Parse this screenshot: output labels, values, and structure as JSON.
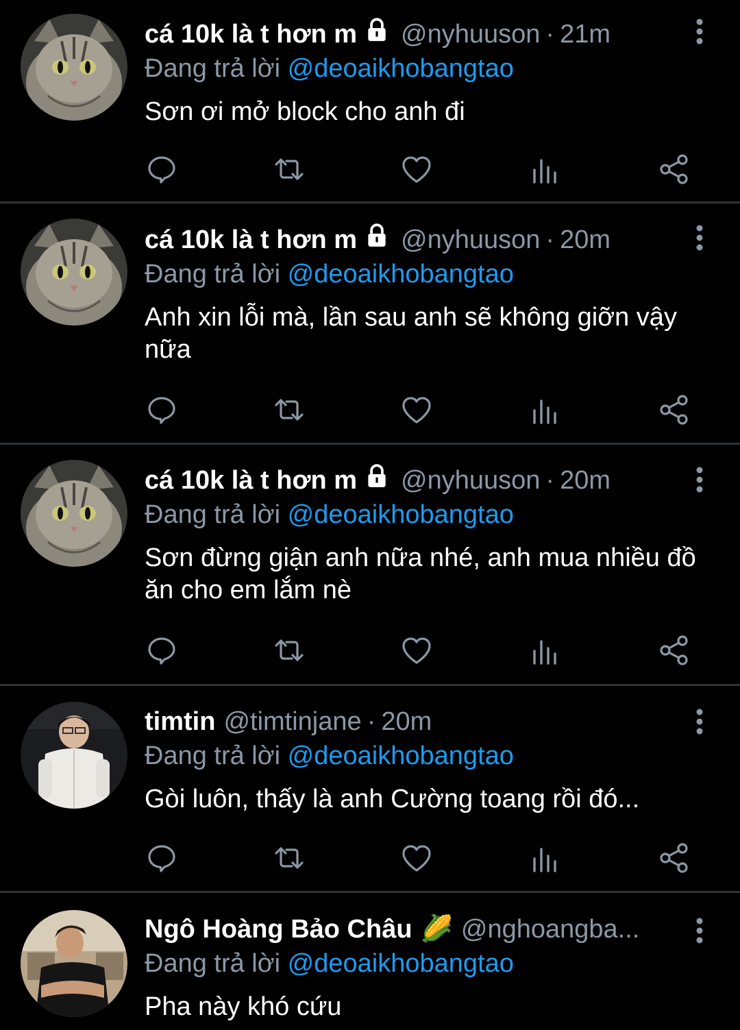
{
  "theme": {
    "background": "#000000",
    "text": "#ffffff",
    "muted": "#8b98a5",
    "mention": "#1d9bf0",
    "divider": "#2f3336"
  },
  "tweets": [
    {
      "name": "cá 10k là t hơn m",
      "protected": true,
      "handle": "@nyhuuson",
      "sep": "·",
      "time": "21m",
      "reply_prefix": "Đang trả lời",
      "reply_to": "@deoaikhobangtao",
      "text": "Sơn ơi mở block cho anh đi",
      "avatar": "cat-avatar"
    },
    {
      "name": "cá 10k là t hơn m",
      "protected": true,
      "handle": "@nyhuuson",
      "sep": "·",
      "time": "20m",
      "reply_prefix": "Đang trả lời",
      "reply_to": "@deoaikhobangtao",
      "text": "Anh xin lỗi mà, lần sau anh sẽ không giỡn vậy nữa",
      "avatar": "cat-avatar"
    },
    {
      "name": "cá 10k là t hơn m",
      "protected": true,
      "handle": "@nyhuuson",
      "sep": "·",
      "time": "20m",
      "reply_prefix": "Đang trả lời",
      "reply_to": "@deoaikhobangtao",
      "text": "Sơn đừng giận anh nữa nhé, anh mua nhiều đồ ăn cho em lắm nè",
      "avatar": "cat-avatar"
    },
    {
      "name": "timtin",
      "protected": false,
      "handle": "@timtinjane",
      "sep": "·",
      "time": "20m",
      "reply_prefix": "Đang trả lời",
      "reply_to": "@deoaikhobangtao",
      "text": "Gòi luôn, thấy là anh Cường toang rồi đó...",
      "avatar": "person-white-shirt-avatar"
    },
    {
      "name": "Ngô Hoàng Bảo Châu",
      "emoji": "🌽",
      "protected": false,
      "handle": "@nghoangba...",
      "reply_prefix": "Đang trả lời",
      "reply_to": "@deoaikhobangtao",
      "text": "Pha này khó cứu",
      "avatar": "person-black-shirt-avatar"
    }
  ],
  "actions": [
    "reply-icon",
    "retweet-icon",
    "like-icon",
    "analytics-icon",
    "share-icon"
  ]
}
